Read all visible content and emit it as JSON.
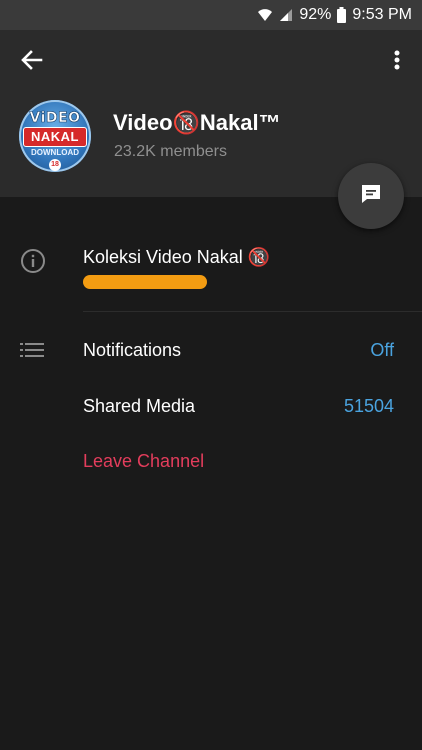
{
  "status_bar": {
    "battery": "92%",
    "time": "9:53 PM"
  },
  "header": {
    "channel_name": "Video🔞Nakal™",
    "members": "23.2K members",
    "avatar": {
      "line1": "ViDEO",
      "line2": "NAKAL",
      "line3": "DOWNLOAD",
      "badge": "18"
    }
  },
  "info": {
    "about": "Koleksi Video Nakal 🔞"
  },
  "rows": {
    "notifications_label": "Notifications",
    "notifications_value": "Off",
    "shared_media_label": "Shared Media",
    "shared_media_value": "51504",
    "leave_label": "Leave Channel"
  },
  "colors": {
    "background": "#1a1a1a",
    "header": "#2b2b2b",
    "accent_blue": "#4aa3df",
    "leave_red": "#e33d5c",
    "scribble_orange": "#f39c12"
  },
  "icons": [
    "wifi-icon",
    "signal-icon",
    "battery-icon",
    "back-arrow-icon",
    "more-vert-icon",
    "message-icon",
    "info-icon",
    "list-icon"
  ]
}
